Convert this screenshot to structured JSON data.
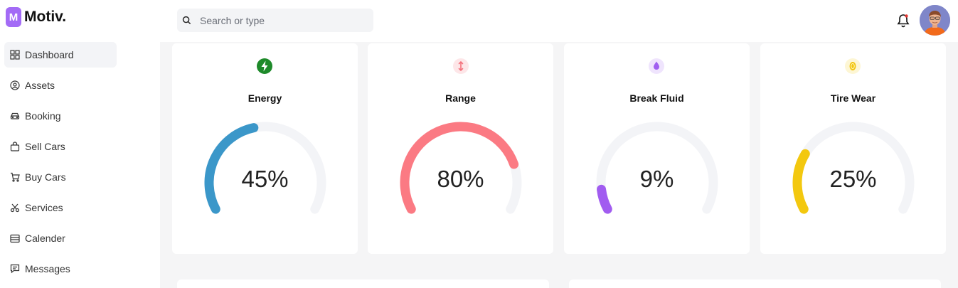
{
  "brand": {
    "logo_letter": "M",
    "name": "Motiv."
  },
  "sidebar": {
    "items": [
      {
        "label": "Dashboard",
        "icon": "grid-icon",
        "active": true
      },
      {
        "label": "Assets",
        "icon": "circle-user-icon"
      },
      {
        "label": "Booking",
        "icon": "car-icon"
      },
      {
        "label": "Sell Cars",
        "icon": "bag-icon"
      },
      {
        "label": "Buy Cars",
        "icon": "cart-icon"
      },
      {
        "label": "Services",
        "icon": "scissors-icon"
      },
      {
        "label": "Calender",
        "icon": "calendar-icon"
      },
      {
        "label": "Messages",
        "icon": "message-icon"
      }
    ]
  },
  "header": {
    "search_placeholder": "Search or type"
  },
  "stats": [
    {
      "title": "Energy",
      "value": 45,
      "display": "45%",
      "color": "#3b97c9",
      "icon": "bolt-icon",
      "icon_color": "#1e8a2a",
      "icon_bg": "#ffffff"
    },
    {
      "title": "Range",
      "value": 80,
      "display": "80%",
      "color": "#fb7a83",
      "icon": "arrows-vertical-icon",
      "icon_color": "#f4727d",
      "icon_bg": "#fde6e8"
    },
    {
      "title": "Break Fluid",
      "value": 9,
      "display": "9%",
      "color": "#a15cf0",
      "icon": "drop-icon",
      "icon_color": "#a05ff0",
      "icon_bg": "#efe4fd"
    },
    {
      "title": "Tire Wear",
      "value": 25,
      "display": "25%",
      "color": "#f3c80f",
      "icon": "coin-icon",
      "icon_color": "#f2c50e",
      "icon_bg": "#fdf6d4"
    }
  ],
  "gauge_track_color": "#f3f4f7"
}
